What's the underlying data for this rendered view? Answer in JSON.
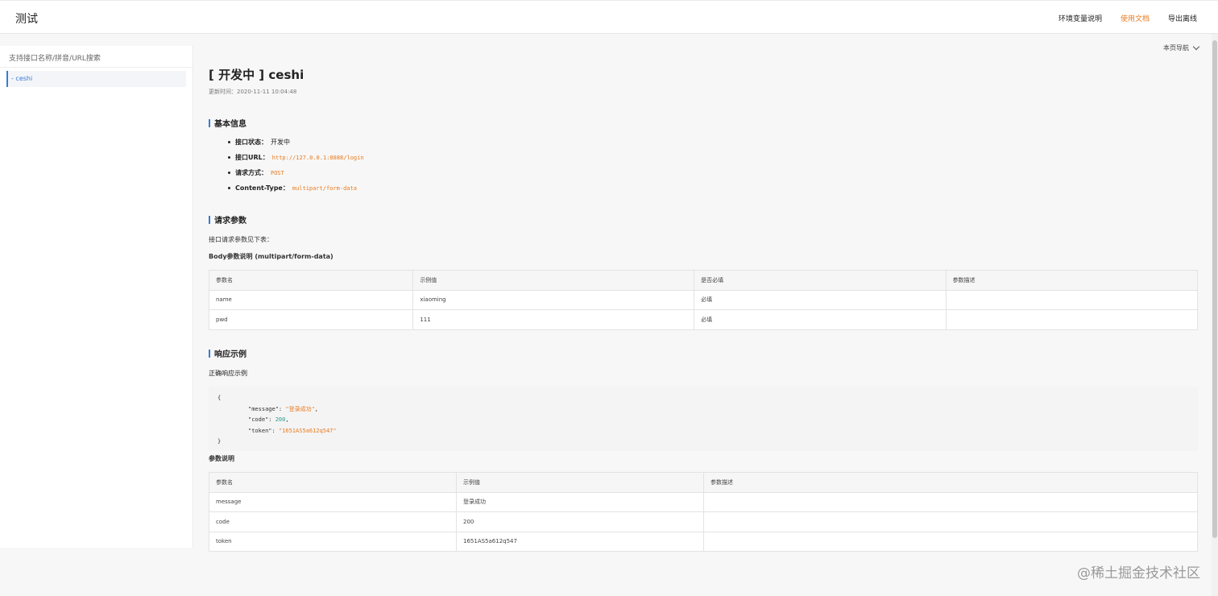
{
  "header": {
    "title": "测试",
    "nav": [
      {
        "label": "环境变量说明",
        "active": false
      },
      {
        "label": "使用文档",
        "active": true
      },
      {
        "label": "导出离线",
        "active": false
      }
    ]
  },
  "sidebar": {
    "search_placeholder": "支持接口名称/拼音/URL搜索",
    "items": [
      {
        "label": "- ceshi"
      }
    ]
  },
  "toc_label": "本页导航",
  "doc": {
    "status_tag": "[ 开发中 ]",
    "name": "ceshi",
    "updated": "更新时间：2020-11-11 10:04:48"
  },
  "basic_info": {
    "heading": "基本信息",
    "items": [
      {
        "key": "接口状态：",
        "value": "开发中",
        "mono": false
      },
      {
        "key": "接口URL：",
        "value": "http://127.0.0.1:8888/login",
        "mono": true
      },
      {
        "key": "请求方式：",
        "value": "POST",
        "mono": true
      },
      {
        "key": "Content-Type：",
        "value": "multipart/form-data",
        "mono": true
      }
    ]
  },
  "request_params": {
    "heading": "请求参数",
    "intro": "接口请求参数见下表：",
    "body_title": "Body参数说明 (multipart/form-data)",
    "columns": [
      "参数名",
      "示例值",
      "是否必填",
      "参数描述"
    ],
    "rows": [
      [
        "name",
        "xiaoming",
        "必填",
        ""
      ],
      [
        "pwd",
        "111",
        "必填",
        ""
      ]
    ]
  },
  "response": {
    "heading": "响应示例",
    "success_title": "正确响应示例",
    "code_lines": [
      {
        "indent": false,
        "key": "",
        "value": "{",
        "kind": "plain"
      },
      {
        "indent": true,
        "key": "\"message\": ",
        "value": "\"登录成功\"",
        "suffix": ",",
        "kind": "str"
      },
      {
        "indent": true,
        "key": "\"code\": ",
        "value": "200",
        "suffix": ",",
        "kind": "num"
      },
      {
        "indent": true,
        "key": "\"token\": ",
        "value": "\"1651AS5a612q547\"",
        "suffix": "",
        "kind": "str"
      },
      {
        "indent": false,
        "key": "",
        "value": "}",
        "kind": "plain"
      }
    ],
    "params_title": "参数说明",
    "columns": [
      "参数名",
      "示例值",
      "参数描述"
    ],
    "rows": [
      [
        "message",
        "登录成功",
        ""
      ],
      [
        "code",
        "200",
        ""
      ],
      [
        "token",
        "1651AS5a612q547",
        ""
      ]
    ]
  },
  "watermark": "@稀土掘金技术社区"
}
